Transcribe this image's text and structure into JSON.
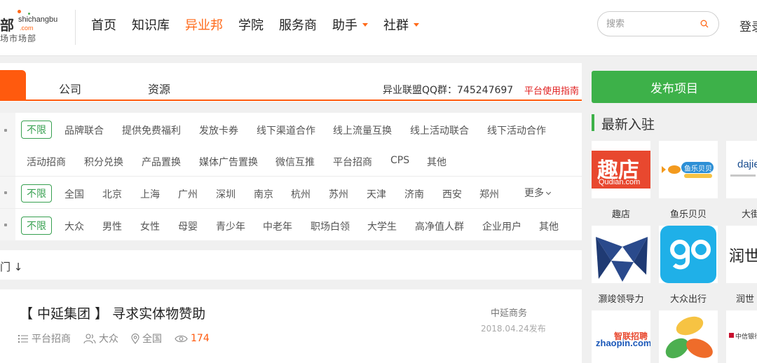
{
  "header": {
    "logo": {
      "char": "部",
      "en": "shichangbu",
      "com": ".com",
      "cn": "场市场部"
    },
    "nav": [
      {
        "label": "首页",
        "active": false,
        "dropdown": false
      },
      {
        "label": "知识库",
        "active": false,
        "dropdown": false
      },
      {
        "label": "异业邦",
        "active": true,
        "dropdown": false
      },
      {
        "label": "学院",
        "active": false,
        "dropdown": false
      },
      {
        "label": "服务商",
        "active": false,
        "dropdown": false
      },
      {
        "label": "助手",
        "active": false,
        "dropdown": true
      },
      {
        "label": "社群",
        "active": false,
        "dropdown": true
      }
    ],
    "search_placeholder": "搜索",
    "login": "登录"
  },
  "tabs": {
    "items": [
      "公司",
      "资源"
    ],
    "qq": "异业联盟QQ群：745247697",
    "guide": "平台使用指南"
  },
  "filters": {
    "row1": [
      "不限",
      "品牌联合",
      "提供免费福利",
      "发放卡券",
      "线下渠道合作",
      "线上流量互换",
      "线上活动联合",
      "线下活动合作"
    ],
    "row1b": [
      "活动招商",
      "积分兑换",
      "产品置换",
      "媒体广告置换",
      "微信互推",
      "平台招商",
      "CPS",
      "其他"
    ],
    "row2": [
      "不限",
      "全国",
      "北京",
      "上海",
      "广州",
      "深圳",
      "南京",
      "杭州",
      "苏州",
      "天津",
      "济南",
      "西安",
      "郑州"
    ],
    "more": "更多",
    "row3": [
      "不限",
      "大众",
      "男性",
      "女性",
      "母婴",
      "青少年",
      "中老年",
      "职场白领",
      "大学生",
      "高净值人群",
      "企业用户",
      "其他"
    ]
  },
  "sort": {
    "label": "门 ↓"
  },
  "listing": {
    "title": "【 中延集团 】 寻求实体物赞助",
    "category": "平台招商",
    "audience": "大众",
    "region": "全国",
    "views": "174",
    "company": "中延商务",
    "date": "2018.04.24发布"
  },
  "sidebar": {
    "publish": "发布项目",
    "newest": "最新入驻",
    "brands": [
      {
        "name": "趣店",
        "logo_text": "趣店",
        "logo_sub": "Qudian.com"
      },
      {
        "name": "鱼乐贝贝",
        "logo_text": "鱼乐贝贝"
      },
      {
        "name": "大街",
        "logo_text": "dajie"
      },
      {
        "name": "灏竣领导力",
        "logo_text": ""
      },
      {
        "name": "大众出行",
        "logo_text": "go"
      },
      {
        "name": "润世",
        "logo_text": "润世"
      },
      {
        "name": "",
        "logo_text": "zhaopin.com",
        "logo_sub": "智联招聘"
      },
      {
        "name": "",
        "logo_text": ""
      },
      {
        "name": "",
        "logo_text": "中信银行"
      }
    ]
  },
  "colors": {
    "accent": "#ff5a0e",
    "green": "#3db149",
    "red": "#e02020"
  }
}
